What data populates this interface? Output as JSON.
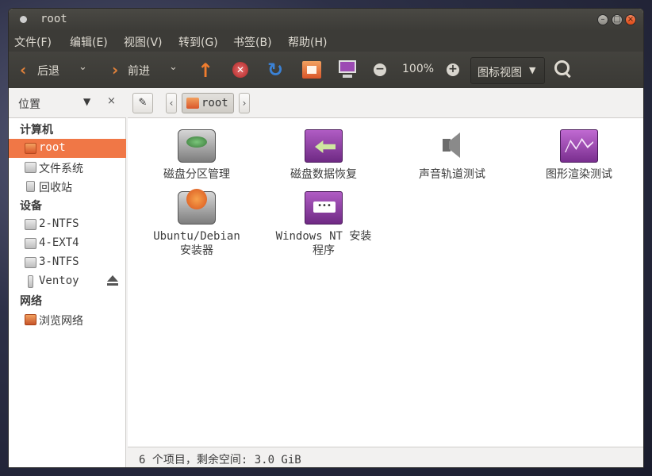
{
  "window": {
    "title": "root"
  },
  "menubar": {
    "items": [
      "文件(F)",
      "编辑(E)",
      "视图(V)",
      "转到(G)",
      "书签(B)",
      "帮助(H)"
    ]
  },
  "toolbar": {
    "back_label": "后退",
    "forward_label": "前进",
    "zoom_level": "100%",
    "view_mode": "图标视图",
    "zoom_minus": "−",
    "zoom_plus": "+"
  },
  "sidebar_header": {
    "label": "位置",
    "close": "×"
  },
  "pathbar": {
    "current": "root"
  },
  "sidebar": {
    "sections": [
      {
        "title": "计算机",
        "items": [
          {
            "label": "root",
            "icon": "home-folder-icon",
            "selected": true
          },
          {
            "label": "文件系统",
            "icon": "drive-icon"
          },
          {
            "label": "回收站",
            "icon": "trash-icon"
          }
        ]
      },
      {
        "title": "设备",
        "items": [
          {
            "label": "2-NTFS",
            "icon": "drive-icon"
          },
          {
            "label": "4-EXT4",
            "icon": "drive-icon"
          },
          {
            "label": "3-NTFS",
            "icon": "drive-icon"
          },
          {
            "label": "Ventoy",
            "icon": "usb-icon",
            "ejectable": true
          }
        ]
      },
      {
        "title": "网络",
        "items": [
          {
            "label": "浏览网络",
            "icon": "network-icon"
          }
        ]
      }
    ]
  },
  "files": [
    {
      "name": "磁盘分区管理",
      "icon": "disk-partition-icon"
    },
    {
      "name": "磁盘数据恢复",
      "icon": "data-recovery-icon"
    },
    {
      "name": "声音轨道测试",
      "icon": "speaker-icon"
    },
    {
      "name": "图形渲染测试",
      "icon": "graph-icon"
    },
    {
      "name": "Ubuntu/Debian",
      "name2": "安装器",
      "icon": "ubuntu-installer-icon"
    },
    {
      "name": "Windows NT 安装",
      "name2": "程序",
      "icon": "windows-nt-installer-icon"
    }
  ],
  "status": {
    "text": "6 个项目，剩余空间: 3.0 GiB"
  },
  "colors": {
    "accent": "#f07746",
    "titlebar": "#3c3b37"
  }
}
